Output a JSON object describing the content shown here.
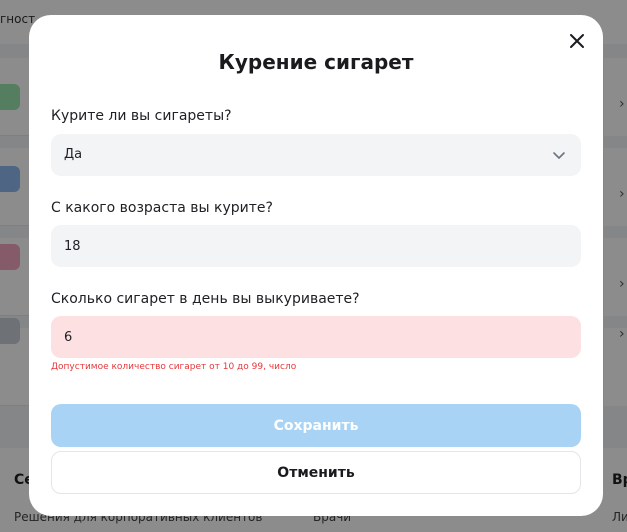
{
  "background": {
    "top_text": "гност",
    "footer_left": "Се",
    "footer_right": "Вр",
    "footer_sub": "Решения для корпоративных клиентов",
    "footer_mid": "Врачи",
    "footer_rsub": "Ли",
    "right_glyph": "›"
  },
  "modal": {
    "title": "Курение сигарет",
    "close_icon": "close-icon",
    "q1": {
      "label": "Курите ли вы сигареты?",
      "value": "Да"
    },
    "q2": {
      "label": "С какого возраста вы курите?",
      "value": "18"
    },
    "q3": {
      "label": "Сколько сигарет в день вы выкуриваете?",
      "value": "6",
      "error": "Допустимое количество сигарет от 10 до 99, число"
    },
    "save_label": "Сохранить",
    "cancel_label": "Отменить"
  },
  "colors": {
    "accent_disabled": "#a9d3f4",
    "error": "#e5383b",
    "error_bg": "#fde0e2",
    "field_bg": "#f3f4f6"
  }
}
